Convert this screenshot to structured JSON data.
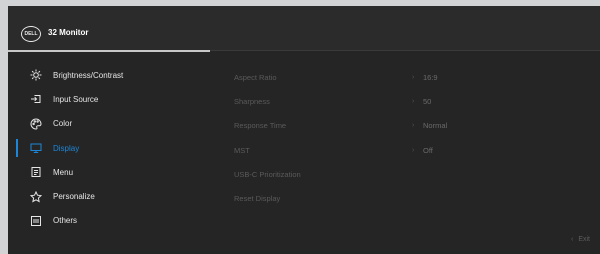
{
  "header": {
    "logo": "DELL",
    "title": "32 Monitor"
  },
  "menu": [
    {
      "label": "Brightness/Contrast",
      "icon": "brightness-icon",
      "active": false
    },
    {
      "label": "Input Source",
      "icon": "input-source-icon",
      "active": false
    },
    {
      "label": "Color",
      "icon": "color-palette-icon",
      "active": false
    },
    {
      "label": "Display",
      "icon": "display-icon",
      "active": true
    },
    {
      "label": "Menu",
      "icon": "menu-icon",
      "active": false
    },
    {
      "label": "Personalize",
      "icon": "star-icon",
      "active": false
    },
    {
      "label": "Others",
      "icon": "others-icon",
      "active": false
    }
  ],
  "settings": [
    {
      "label": "Aspect Ratio",
      "value": "16:9"
    },
    {
      "label": "Sharpness",
      "value": "50"
    },
    {
      "label": "Response Time",
      "value": "Normal"
    },
    {
      "label": "MST",
      "value": "Off"
    },
    {
      "label": "USB-C Prioritization",
      "value": ""
    },
    {
      "label": "Reset Display",
      "value": ""
    }
  ],
  "footer": {
    "exit_label": "Exit"
  },
  "colors": {
    "accent": "#1d86d8",
    "background": "#252525"
  }
}
